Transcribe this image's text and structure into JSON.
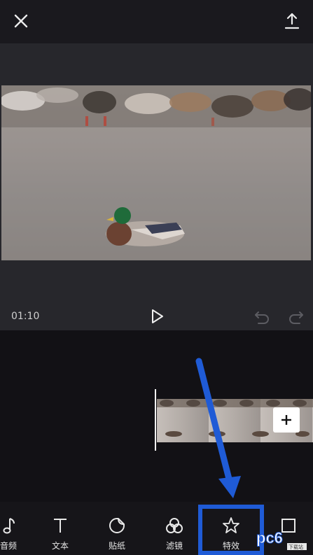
{
  "header": {
    "close_icon": "close-icon",
    "export_icon": "export-icon"
  },
  "preview": {
    "timecode": "01:10"
  },
  "timeline": {
    "add_icon": "plus-icon"
  },
  "toolbar": {
    "items": [
      {
        "label": "音频",
        "icon": "music-note-icon"
      },
      {
        "label": "文本",
        "icon": "text-icon"
      },
      {
        "label": "贴纸",
        "icon": "sticker-icon"
      },
      {
        "label": "滤镜",
        "icon": "filter-icon"
      },
      {
        "label": "特效",
        "icon": "star-effect-icon"
      },
      {
        "label": "",
        "icon": "frame-icon"
      }
    ]
  },
  "watermark": {
    "text": "pc6",
    "sub": "下载站"
  },
  "colors": {
    "highlight": "#1f5bd6",
    "background": "#161519"
  }
}
